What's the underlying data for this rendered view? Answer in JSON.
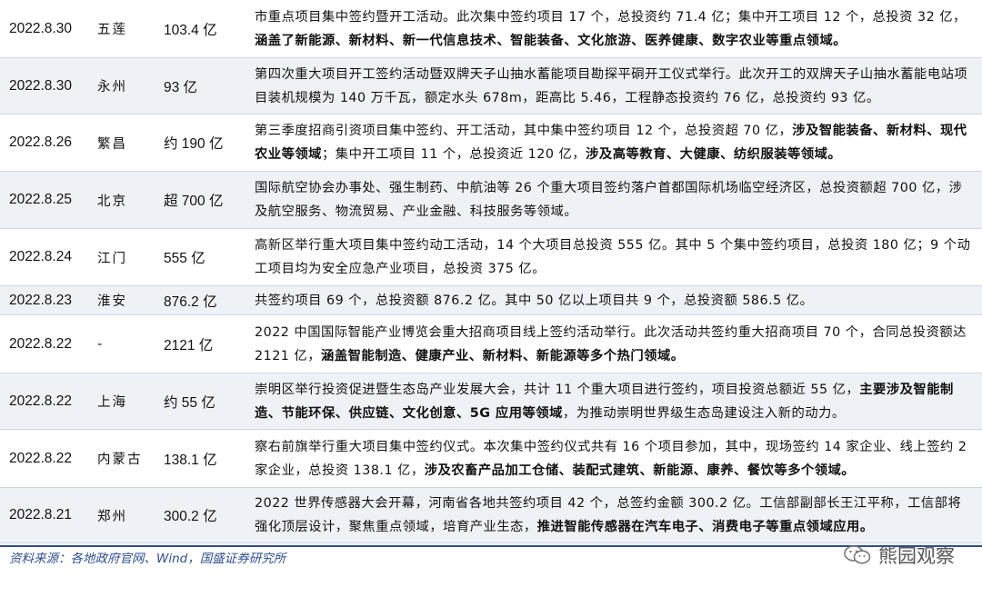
{
  "rows": [
    {
      "date": "2022.8.30",
      "city": "五莲",
      "amount": "103.4 亿",
      "desc": [
        {
          "t": "市重点项目集中签约暨开工活动。此次集中签约项目 17 个，总投资约 71.4 亿；集中开工项目 12 个，总投资 32 亿，",
          "b": false
        },
        {
          "t": "涵盖了新能源、新材料、新一代信息技术、智能装备、文化旅游、医养健康、数字农业等重点领域。",
          "b": true
        }
      ]
    },
    {
      "date": "2022.8.30",
      "city": "永州",
      "amount": "93 亿",
      "desc": [
        {
          "t": "第四次重大项目开工签约活动暨双牌天子山抽水蓄能项目勘探平硐开工仪式举行。此次开工的双牌天子山抽水蓄能电站项目装机规模为 140 万千瓦，额定水头 678m，距高比 5.46，工程静态投资约 76 亿，总投资约 93 亿。",
          "b": false
        }
      ]
    },
    {
      "date": "2022.8.26",
      "city": "繁昌",
      "amount": "约 190 亿",
      "desc": [
        {
          "t": "第三季度招商引资项目集中签约、开工活动，其中集中签约项目 12 个，总投资超 70 亿，",
          "b": false
        },
        {
          "t": "涉及智能装备、新材料、现代农业等领域",
          "b": true
        },
        {
          "t": "；集中开工项目 11 个，总投资近 120 亿，",
          "b": false
        },
        {
          "t": "涉及高等教育、大健康、纺织服装等领域。",
          "b": true
        }
      ]
    },
    {
      "date": "2022.8.25",
      "city": "北京",
      "amount": "超 700 亿",
      "desc": [
        {
          "t": "国际航空协会办事处、强生制药、中航油等 26 个重大项目签约落户首都国际机场临空经济区，总投资额超 700 亿，涉及航空服务、物流贸易、产业金融、科技服务等领域。",
          "b": false
        }
      ]
    },
    {
      "date": "2022.8.24",
      "city": "江门",
      "amount": "555 亿",
      "desc": [
        {
          "t": "高新区举行重大项目集中签约动工活动，14 个大项目总投资 555 亿。其中 5 个集中签约项目，总投资 180 亿；9 个动工项目均为安全应急产业项目，总投资 375 亿。",
          "b": false
        }
      ]
    },
    {
      "date": "2022.8.23",
      "city": "淮安",
      "amount": "876.2 亿",
      "desc": [
        {
          "t": "共签约项目 69 个，总投资额 876.2 亿。其中 50 亿以上项目共 9 个，总投资额 586.5 亿。",
          "b": false
        }
      ]
    },
    {
      "date": "2022.8.22",
      "city": "-",
      "amount": "2121 亿",
      "desc": [
        {
          "t": "2022 中国国际智能产业博览会重大招商项目线上签约活动举行。此次活动共签约重大招商项目 70 个，合同总投资额达 2121 亿，",
          "b": false
        },
        {
          "t": "涵盖智能制造、健康产业、新材料、新能源等多个热门领域。",
          "b": true
        }
      ]
    },
    {
      "date": "2022.8.22",
      "city": "上海",
      "amount": "约 55 亿",
      "desc": [
        {
          "t": "崇明区举行投资促进暨生态岛产业发展大会，共计 11 个重大项目进行签约，项目投资总额近 55 亿，",
          "b": false
        },
        {
          "t": "主要涉及智能制造、节能环保、供应链、文化创意、5G 应用等领域",
          "b": true
        },
        {
          "t": "，为推动崇明世界级生态岛建设注入新的动力。",
          "b": false
        }
      ]
    },
    {
      "date": "2022.8.22",
      "city": "内蒙古",
      "amount": "138.1 亿",
      "desc": [
        {
          "t": "察右前旗举行重大项目集中签约仪式。本次集中签约仪式共有 16 个项目参加，其中，现场签约 14 家企业、线上签约 2 家企业，总投资 138.1 亿，",
          "b": false
        },
        {
          "t": "涉及农畜产品加工仓储、装配式建筑、新能源、康养、餐饮等多个领域。",
          "b": true
        }
      ]
    },
    {
      "date": "2022.8.21",
      "city": "郑州",
      "amount": "300.2 亿",
      "desc": [
        {
          "t": "2022 世界传感器大会开幕，河南省各地共签约项目 42 个，总签约金额 300.2 亿。工信部副部长王江平称，工信部将强化顶层设计，聚焦重点领域，培育产业生态，",
          "b": false
        },
        {
          "t": "推进智能传感器在汽车电子、消费电子等重点领域应用。",
          "b": true
        }
      ]
    }
  ],
  "footer": {
    "source": "资料来源：各地政府官网、Wind，国盛证券研究所",
    "watermark": "熊园观察",
    "watermark_icon": "wechat-icon"
  }
}
